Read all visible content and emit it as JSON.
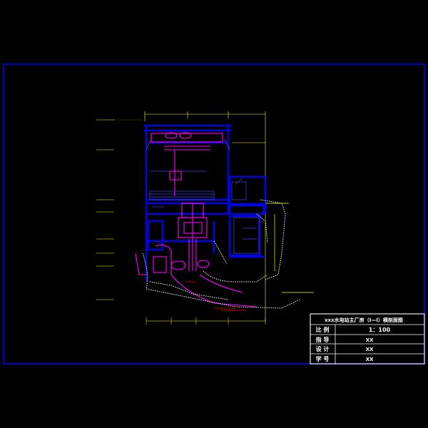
{
  "title_block": {
    "title": "xxx水电站主厂房（I—I）横剖面图",
    "rows": [
      {
        "label": "比 例",
        "value": "1：100"
      },
      {
        "label": "指 导",
        "value": "XX"
      },
      {
        "label": "设 计",
        "value": "XX"
      },
      {
        "label": "学 号",
        "value": "XX"
      }
    ]
  },
  "colors": {
    "background": "#000000",
    "frame": "#0000ff",
    "title_block": "#ffffff",
    "structure": "#0000ff",
    "elevation": "#ffff00",
    "machinery": "#ff00ff",
    "rock": "#ffffff",
    "dimension": "#ffff00",
    "section": "#ff0000"
  }
}
